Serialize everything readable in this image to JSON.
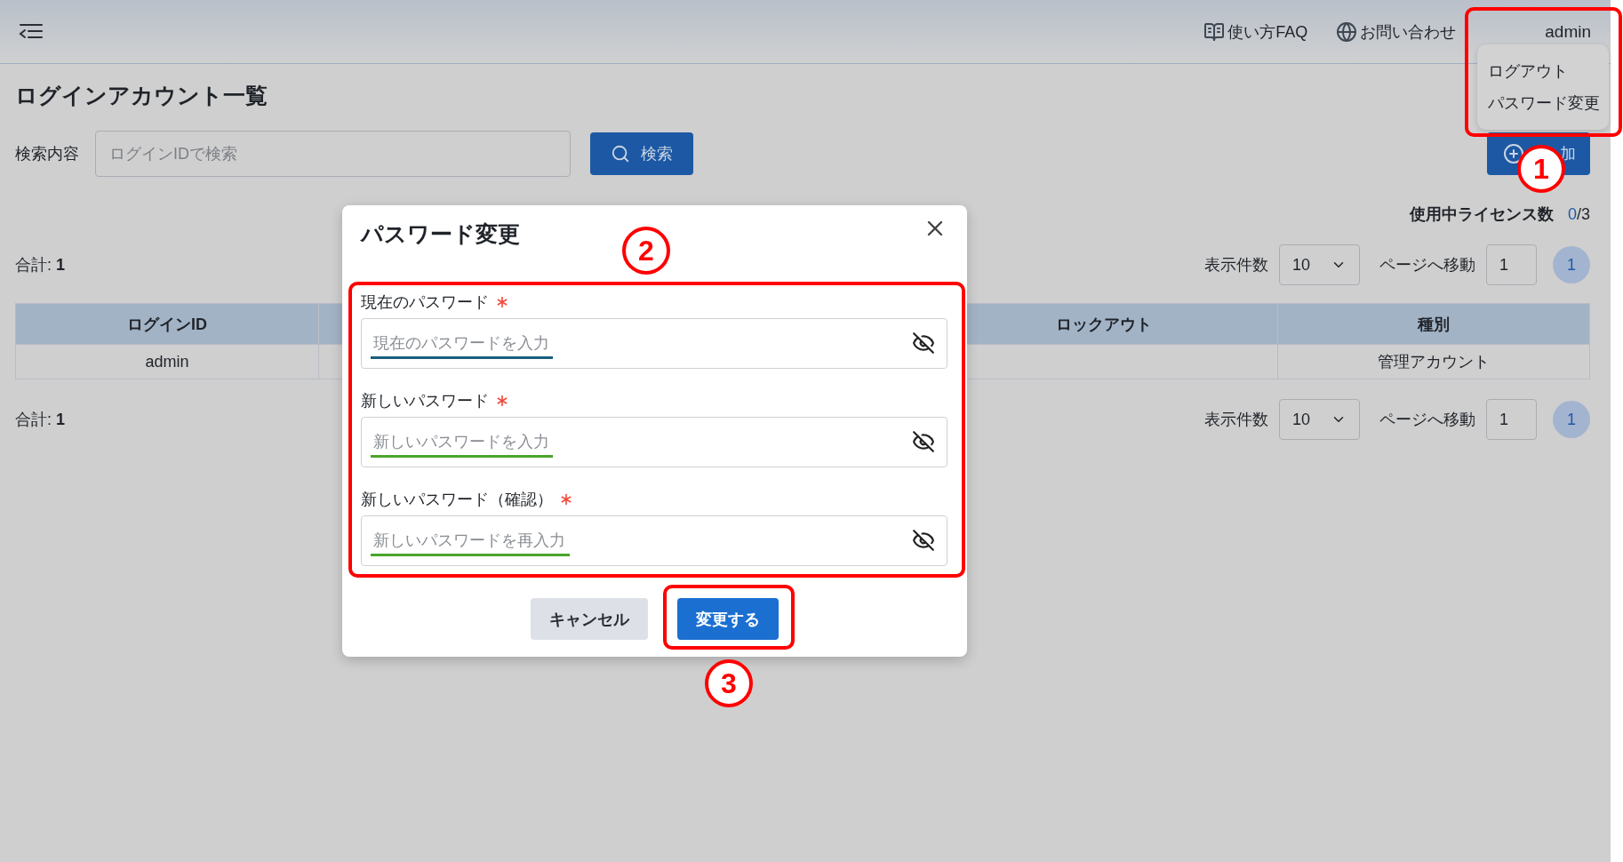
{
  "header": {
    "links": [
      {
        "kind": "faq",
        "label": "使い方FAQ"
      },
      {
        "kind": "contact",
        "label": "お問い合わせ"
      }
    ],
    "user": "admin"
  },
  "user_menu": {
    "items": [
      "ログアウト",
      "パスワード変更"
    ]
  },
  "page": {
    "title": "ログインアカウント一覧",
    "search": {
      "label": "検索内容",
      "placeholder": "ログインIDで検索",
      "button": "検索"
    },
    "add_button": {
      "label": "加"
    },
    "license": {
      "label": "使用中ライセンス数",
      "used": "0",
      "total": "/3"
    },
    "pagers": [
      {
        "total": "合計: **1**",
        "page_size_label": "表示件数",
        "page_size": "10",
        "goto_label": "ページへ移動",
        "goto_value": "1",
        "pages": [
          {
            "label": "1",
            "selected": true
          }
        ]
      },
      {
        "total": "合計: **1**",
        "page_size_label": "表示件数",
        "page_size": "10",
        "goto_label": "ページへ移動",
        "goto_value": "1",
        "pages": [
          {
            "label": "1",
            "selected": true
          }
        ]
      }
    ],
    "table": {
      "columns": [
        "ログインID",
        "ロックアウト",
        "種別"
      ],
      "rows": [
        {
          "login_id": "admin",
          "type": "管理アカウント"
        }
      ]
    }
  },
  "dialog": {
    "title": "パスワード変更",
    "fields": [
      {
        "label": "現在のパスワード",
        "required": true,
        "placeholder": "現在のパスワードを入力",
        "color": "#1a5e7e"
      },
      {
        "label": "新しいパスワード",
        "required": true,
        "placeholder": "新しいパスワードを入力",
        "color": "#4aa52a"
      },
      {
        "label": "新しいパスワード（確認）",
        "required": true,
        "placeholder": "新しいパスワードを再入力",
        "color": "#4aa52a"
      }
    ],
    "buttons": [
      {
        "kind": "secondary",
        "label": "キャンセル"
      },
      {
        "kind": "primary",
        "label": "変更する"
      }
    ]
  },
  "annotations": [
    {
      "number": "1"
    },
    {
      "number": "2"
    },
    {
      "number": "3"
    }
  ]
}
